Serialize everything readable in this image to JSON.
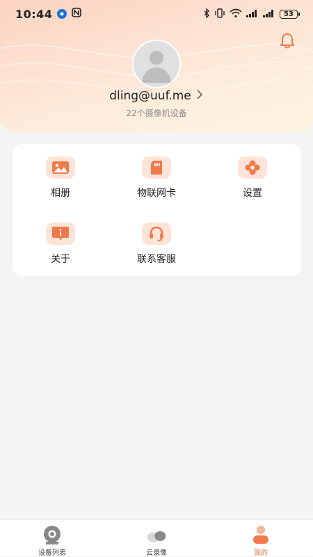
{
  "status_bar": {
    "time": "10:44",
    "battery": "53"
  },
  "profile": {
    "email": "dling@uuf.me",
    "device_count": "22个摄像机设备"
  },
  "menu": {
    "items": [
      {
        "label": "相册",
        "icon": "album-icon"
      },
      {
        "label": "物联网卡",
        "icon": "sim-card-icon"
      },
      {
        "label": "设置",
        "icon": "settings-gear-icon"
      },
      {
        "label": "关于",
        "icon": "info-icon"
      },
      {
        "label": "联系客服",
        "icon": "headset-icon"
      }
    ]
  },
  "tabbar": {
    "items": [
      {
        "label": "设备列表",
        "icon": "camera-icon"
      },
      {
        "label": "云录像",
        "icon": "cloud-icon"
      },
      {
        "label": "我的",
        "icon": "person-icon"
      }
    ],
    "active_index": 2
  },
  "colors": {
    "accent": "#ef7a4a",
    "icon_bg": "#fde3d8",
    "background": "#f4f4f4"
  }
}
